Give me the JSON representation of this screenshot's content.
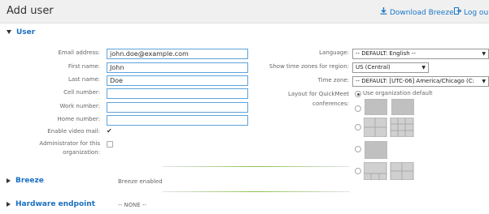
{
  "header": {
    "title": "Add user",
    "download_label": "Download Breeze",
    "logout_label": "Log ou"
  },
  "user_section": {
    "title": "User",
    "fields": {
      "email": {
        "label": "Email address:",
        "value": "john.doe@example.com"
      },
      "first_name": {
        "label": "First name:",
        "value": "John"
      },
      "last_name": {
        "label": "Last name:",
        "value": "Doe"
      },
      "cell": {
        "label": "Cell number:",
        "value": ""
      },
      "work": {
        "label": "Work number:",
        "value": ""
      },
      "home": {
        "label": "Home number:",
        "value": ""
      },
      "video_mail": {
        "label": "Enable video mail:",
        "checked": true
      },
      "admin": {
        "label_line1": "Administrator for this",
        "label_line2": "organization:",
        "checked": false
      }
    },
    "right": {
      "language": {
        "label": "Language:",
        "value": "-- DEFAULT: English --"
      },
      "region": {
        "label": "Show time zones for region:",
        "value": "US (Central)"
      },
      "timezone": {
        "label": "Time zone:",
        "value": "-- DEFAULT: [UTC-06] America/Chicago (C:"
      },
      "layout": {
        "label_line1": "Layout for QuickMeet",
        "label_line2": "conferences:",
        "default_option": "Use organization default"
      }
    }
  },
  "breeze_section": {
    "title": "Breeze",
    "status": "Breeze enabled"
  },
  "hardware_section": {
    "title": "Hardware endpoint",
    "status": "-- NONE --"
  }
}
